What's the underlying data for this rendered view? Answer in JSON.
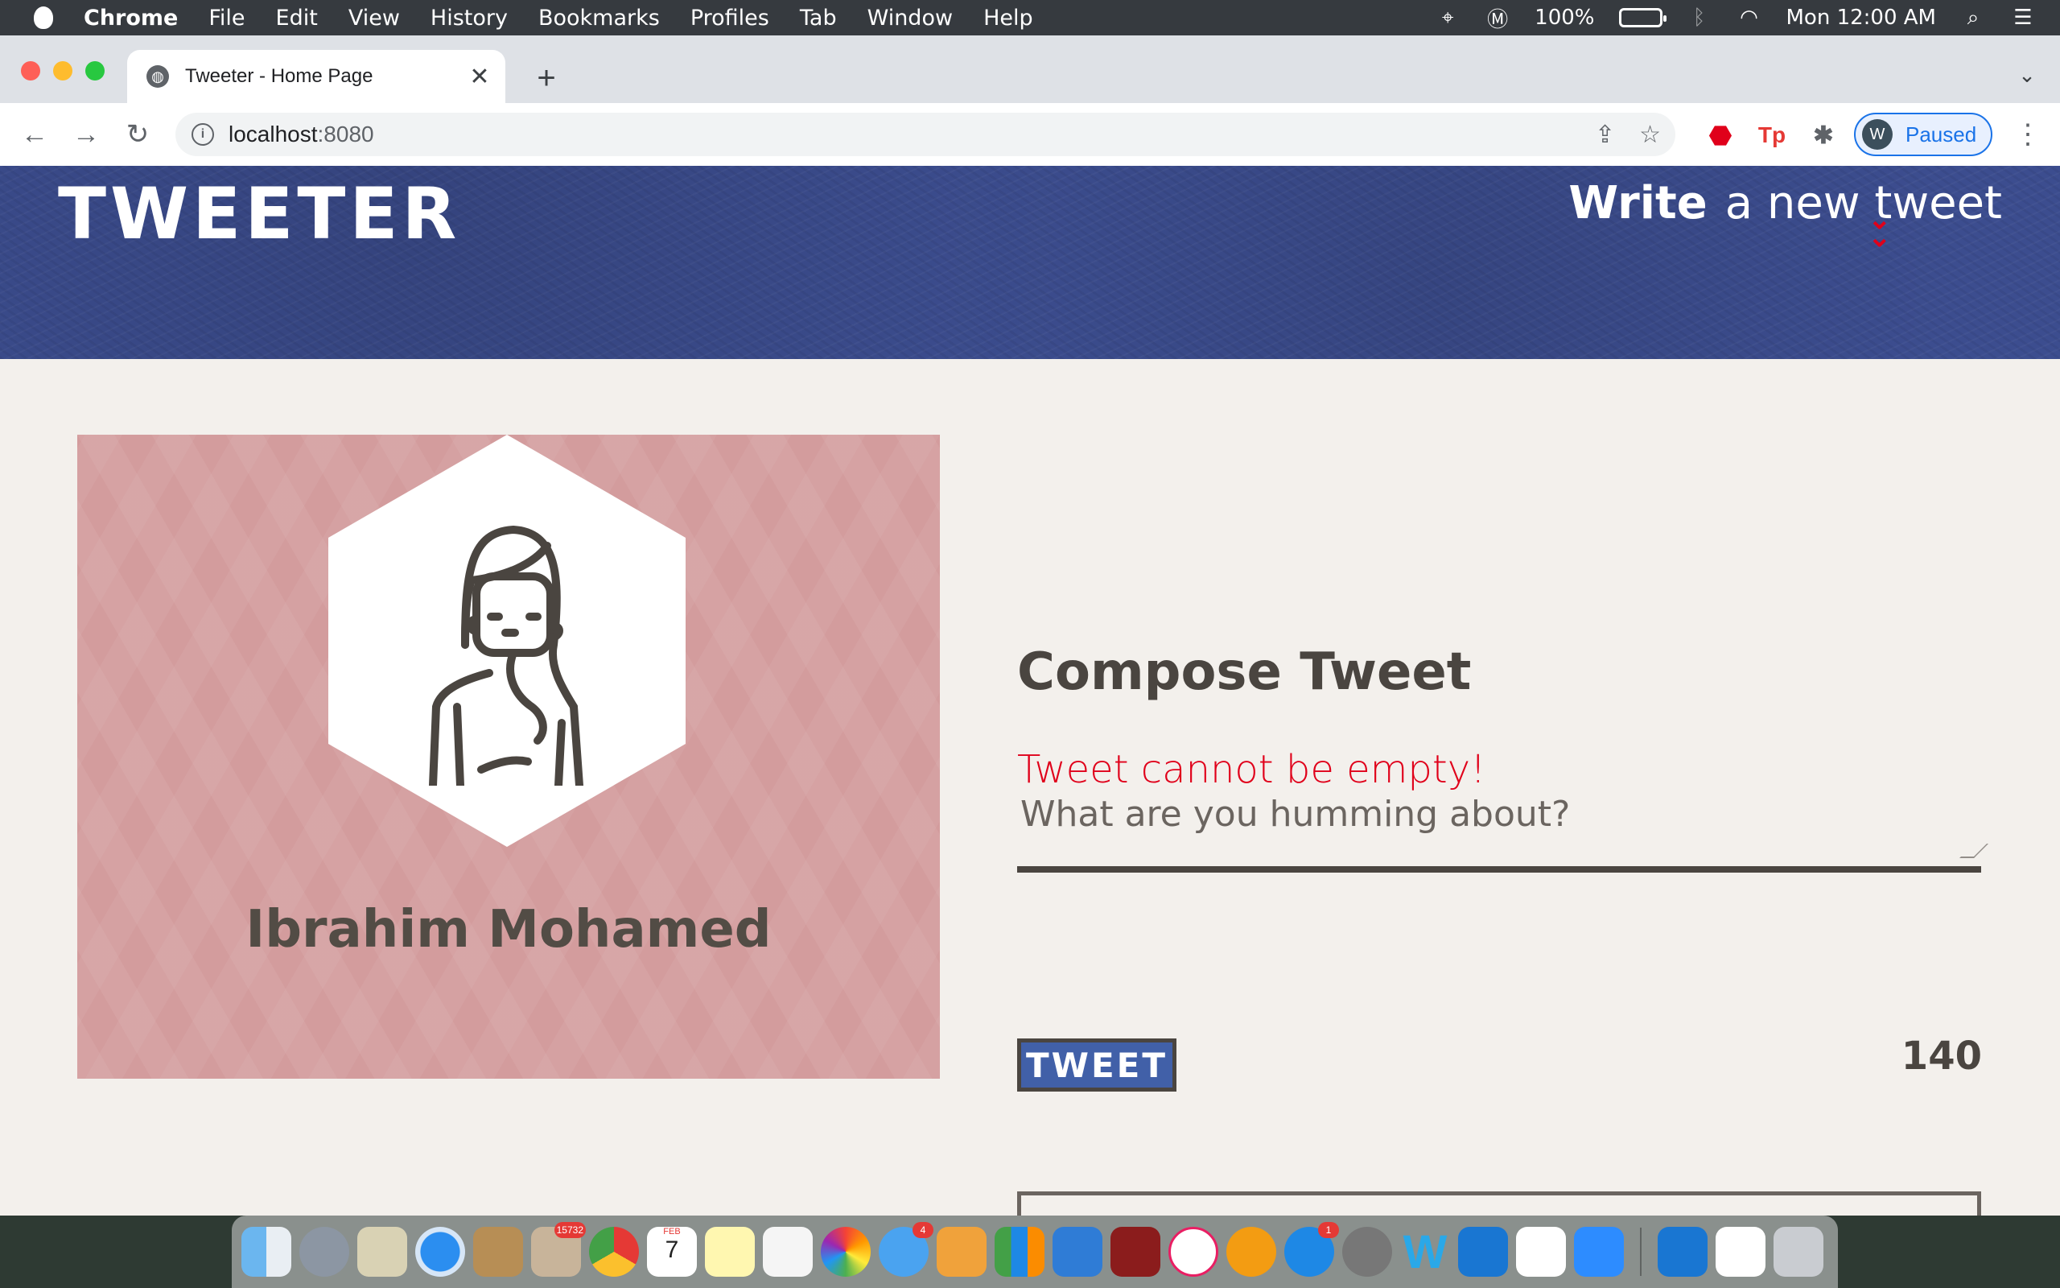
{
  "menubar": {
    "app": "Chrome",
    "items": [
      "File",
      "Edit",
      "View",
      "History",
      "Bookmarks",
      "Profiles",
      "Tab",
      "Window",
      "Help"
    ],
    "battery": "100%",
    "datetime": "Mon 12:00 AM"
  },
  "browser": {
    "tab_title": "Tweeter - Home Page",
    "url_host": "localhost",
    "url_port": ":8080",
    "profile_initial": "W",
    "profile_status": "Paused",
    "ext_tp": "Tp"
  },
  "nav": {
    "brand": "TWEETER",
    "write_bold": "Write",
    "write_rest": "a new tweet"
  },
  "profile": {
    "name": "Ibrahim Mohamed"
  },
  "compose": {
    "title": "Compose Tweet",
    "error": "Tweet cannot be empty!",
    "placeholder": "What are you humming about?",
    "button": "TWEET",
    "counter": "140"
  },
  "dock": {
    "badges": {
      "mail": "15732",
      "calendar_month": "FEB",
      "calendar_day": "7",
      "messages": "4",
      "appstore": "1"
    }
  },
  "colors": {
    "nav_bg": "#3c4d8f",
    "card_bg": "#d39c9d",
    "page_bg": "#f3f0ec",
    "error": "#e0001a",
    "button_bg": "#4160a8"
  }
}
